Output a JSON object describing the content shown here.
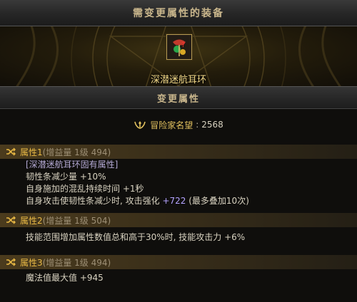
{
  "header": {
    "title": "需变更属性的装备"
  },
  "item": {
    "name": "深潜迷航耳环",
    "icon": "earring-icon"
  },
  "change_header": {
    "title": "变更属性"
  },
  "reputation": {
    "icon": "laurel-icon",
    "label": "冒险家名望",
    "sep": ":",
    "value": "2568"
  },
  "sections": [
    {
      "label": "属性1",
      "meta": "(增益量 1级 494)",
      "lines": {
        "tag": "[深潜迷航耳环固有属性]",
        "l1": "韧性条减少量 +10%",
        "l2": "自身施加的混乱持续时间 +1秒",
        "l3a": "自身攻击使韧性条减少时, 攻击强化 ",
        "l3b": "+722",
        "l3c": " (最多叠加10次)"
      }
    },
    {
      "label": "属性2",
      "meta": "(增益量 1级 504)",
      "lines": {
        "l1": "技能范围增加属性数值总和高于30%时, 技能攻击力 +6%"
      }
    },
    {
      "label": "属性3",
      "meta": "(增益量 1级 494)",
      "lines": {
        "l1": "魔法值最大值 +945"
      }
    }
  ],
  "colors": {
    "accent": "#e9b945",
    "item_name": "#f6dc8a",
    "highlight": "#b4a3ff"
  }
}
